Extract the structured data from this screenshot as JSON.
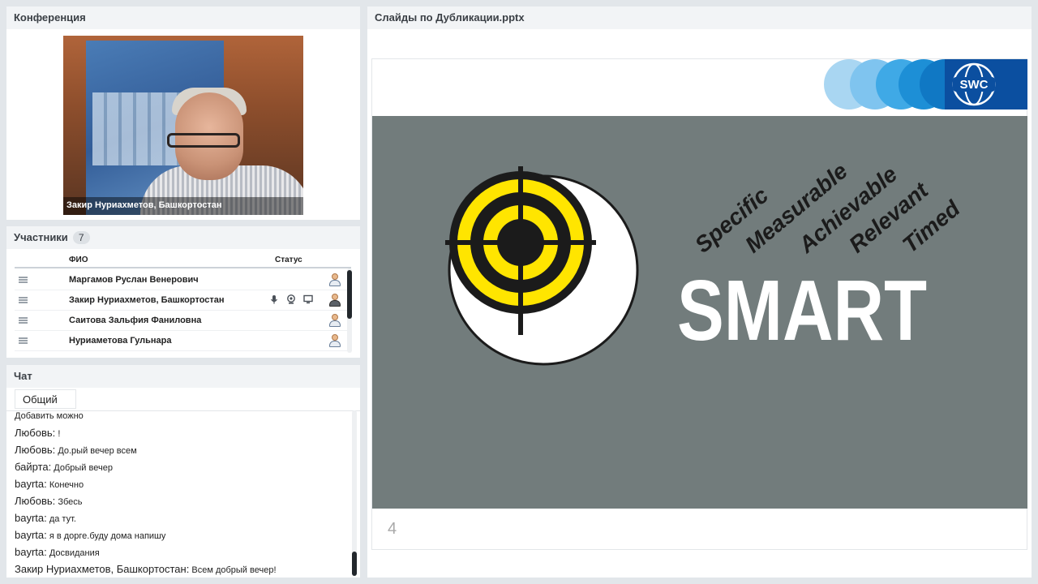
{
  "conference": {
    "title": "Конференция",
    "video_caption": "Закир Нуриахметов, Башкортостан"
  },
  "participants": {
    "title": "Участники",
    "count": "7",
    "col_name": "ФИО",
    "col_status": "Статус",
    "rows": [
      {
        "name": "Маргамов Руслан  Венерович"
      },
      {
        "name": "Закир Нуриахметов, Башкортостан"
      },
      {
        "name": "Саитова  Зальфия Фаниловна"
      },
      {
        "name": "Нуриаметова Гульнара"
      }
    ]
  },
  "chat": {
    "title": "Чат",
    "tab": "Общий",
    "messages": [
      {
        "author": "",
        "text": "Добавить можно"
      },
      {
        "author": "Любовь:",
        "text": "!"
      },
      {
        "author": "Любовь:",
        "text": "До.рый вечер всем"
      },
      {
        "author": "байрта:",
        "text": "Добрый вечер"
      },
      {
        "author": "bayrta:",
        "text": "Конечно"
      },
      {
        "author": "Любовь:",
        "text": "Збесь"
      },
      {
        "author": "bayrta:",
        "text": "да тут."
      },
      {
        "author": "bayrta:",
        "text": "я  в дорге.буду дома напишу"
      },
      {
        "author": "bayrta:",
        "text": "Досвидания"
      },
      {
        "author": "Закир Нуриахметов, Башкортостан:",
        "text": "Всем добрый вечер!"
      }
    ]
  },
  "slides": {
    "title": "Слайды по Дубликации.pptx",
    "logo_text": "SWC",
    "slide_words": [
      "Specific",
      "Measurable",
      "Achievable",
      "Relevant",
      "Timed"
    ],
    "slide_heading": "SMART",
    "page_number": "4"
  }
}
